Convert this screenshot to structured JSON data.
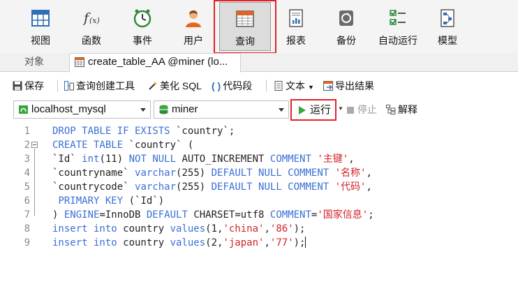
{
  "ribbon": {
    "buttons": [
      {
        "label": "视图",
        "icon": "grid-view-icon",
        "active": false
      },
      {
        "label": "函数",
        "icon": "function-icon",
        "active": false
      },
      {
        "label": "事件",
        "icon": "clock-icon",
        "active": false
      },
      {
        "label": "用户",
        "icon": "user-icon",
        "active": false
      },
      {
        "label": "查询",
        "icon": "query-table-icon",
        "active": true
      },
      {
        "label": "报表",
        "icon": "report-icon",
        "active": false
      },
      {
        "label": "备份",
        "icon": "backup-icon",
        "active": false
      },
      {
        "label": "自动运行",
        "icon": "checklist-icon",
        "active": false
      },
      {
        "label": "模型",
        "icon": "model-icon",
        "active": false
      }
    ]
  },
  "tabs": {
    "objects": "对象",
    "active": "create_table_AA @miner (lo..."
  },
  "toolbar": {
    "save": "保存",
    "query_builder": "查询创建工具",
    "beautify": "美化 SQL",
    "code_snippet": "代码段",
    "text": "文本",
    "export": "导出结果"
  },
  "connection": {
    "server": "localhost_mysql",
    "database": "miner"
  },
  "actions": {
    "run": "运行",
    "stop": "停止",
    "explain": "解释"
  },
  "colors": {
    "highlight": "#e0222a",
    "keyword": "#3a6fd6",
    "string": "#d2232a",
    "run_icon": "#3aa63a"
  },
  "editor": {
    "line_numbers": [
      "1",
      "2",
      "3",
      "4",
      "5",
      "6",
      "7",
      "8",
      "9"
    ],
    "lines": [
      [
        [
          "kw",
          "DROP TABLE IF EXISTS"
        ],
        [
          "t",
          " `country`;"
        ]
      ],
      [
        [
          "kw",
          "CREATE TABLE"
        ],
        [
          "t",
          " `country` ("
        ]
      ],
      [
        [
          "t",
          "`Id` "
        ],
        [
          "kw",
          "int"
        ],
        [
          "t",
          "(11) "
        ],
        [
          "kw",
          "NOT NULL"
        ],
        [
          "t",
          " AUTO_INCREMENT "
        ],
        [
          "kw",
          "COMMENT"
        ],
        [
          "t",
          " "
        ],
        [
          "str",
          "'主键'"
        ],
        [
          "t",
          ","
        ]
      ],
      [
        [
          "t",
          "`countryname` "
        ],
        [
          "kw",
          "varchar"
        ],
        [
          "t",
          "(255) "
        ],
        [
          "kw",
          "DEFAULT NULL COMMENT"
        ],
        [
          "t",
          " "
        ],
        [
          "str",
          "'名称'"
        ],
        [
          "t",
          ","
        ]
      ],
      [
        [
          "t",
          "`countrycode` "
        ],
        [
          "kw",
          "varchar"
        ],
        [
          "t",
          "(255) "
        ],
        [
          "kw",
          "DEFAULT NULL COMMENT"
        ],
        [
          "t",
          " "
        ],
        [
          "str",
          "'代码'"
        ],
        [
          "t",
          ","
        ]
      ],
      [
        [
          "t",
          " "
        ],
        [
          "kw",
          "PRIMARY KEY"
        ],
        [
          "t",
          " (`Id`)"
        ]
      ],
      [
        [
          "t",
          ") "
        ],
        [
          "kw",
          "ENGINE"
        ],
        [
          "t",
          "=InnoDB "
        ],
        [
          "kw",
          "DEFAULT"
        ],
        [
          "t",
          " CHARSET=utf8 "
        ],
        [
          "kw",
          "COMMENT"
        ],
        [
          "t",
          "="
        ],
        [
          "str",
          "'国家信息'"
        ],
        [
          "t",
          ";"
        ]
      ],
      [
        [
          "kw",
          "insert into"
        ],
        [
          "t",
          " country "
        ],
        [
          "kw",
          "values"
        ],
        [
          "t",
          "(1,"
        ],
        [
          "str",
          "'china'"
        ],
        [
          "t",
          ","
        ],
        [
          "str",
          "'86'"
        ],
        [
          "t",
          ");"
        ]
      ],
      [
        [
          "kw",
          "insert into"
        ],
        [
          "t",
          " country "
        ],
        [
          "kw",
          "values"
        ],
        [
          "t",
          "(2,"
        ],
        [
          "str",
          "'japan'"
        ],
        [
          "t",
          ","
        ],
        [
          "str",
          "'77'"
        ],
        [
          "t",
          ");"
        ]
      ]
    ]
  }
}
